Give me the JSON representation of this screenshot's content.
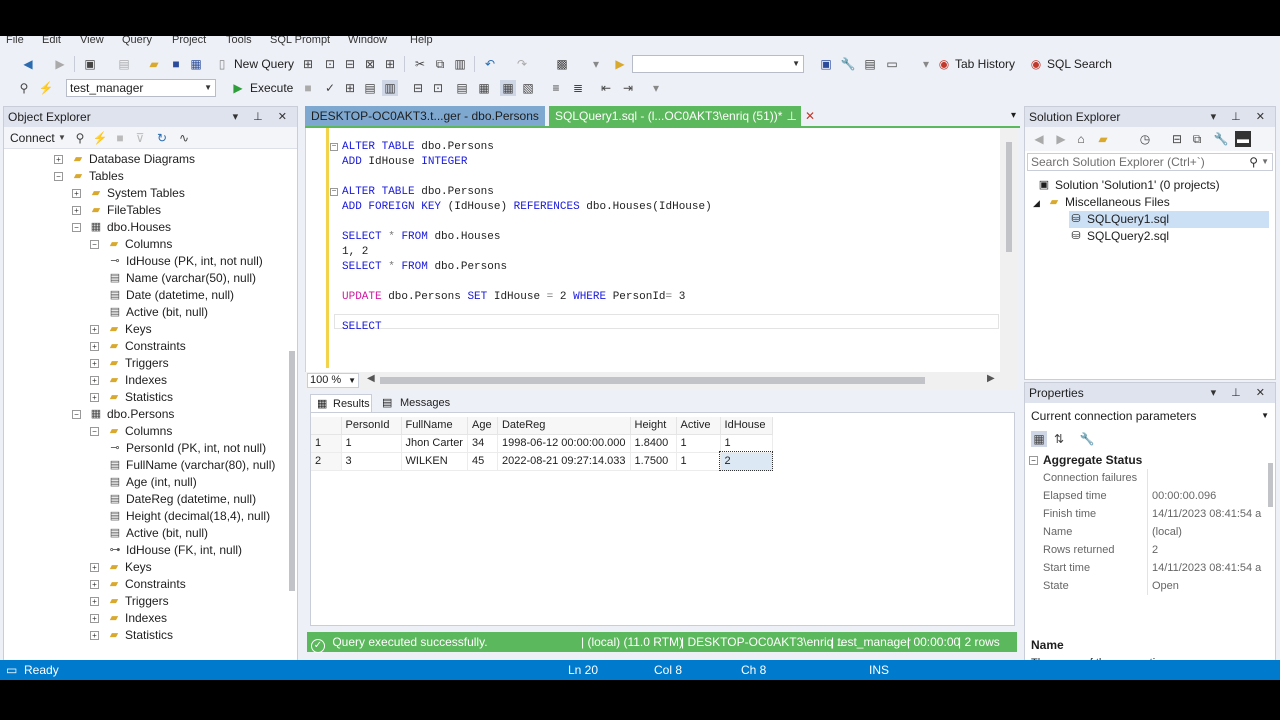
{
  "menu": [
    "File",
    "Edit",
    "View",
    "Query",
    "Project",
    "Tools",
    "SQL Prompt",
    "Window",
    "Help"
  ],
  "toolbar": {
    "new_query": "New Query",
    "execute": "Execute",
    "database": "test_manager",
    "tab_history": "Tab History",
    "sql_search": "SQL Search"
  },
  "object_explorer": {
    "title": "Object Explorer",
    "connect": "Connect",
    "nodes": [
      {
        "label": "Database Diagrams",
        "kind": "folder",
        "exp": "+"
      },
      {
        "label": "Tables",
        "kind": "folder",
        "exp": "-"
      },
      {
        "label": "System Tables",
        "kind": "folder",
        "exp": "+"
      },
      {
        "label": "FileTables",
        "kind": "folder",
        "exp": "+"
      },
      {
        "label": "dbo.Houses",
        "kind": "table",
        "exp": "-"
      },
      {
        "label": "Columns",
        "kind": "folder",
        "exp": "-"
      },
      {
        "label": "IdHouse (PK, int, not null)",
        "kind": "key",
        "exp": ""
      },
      {
        "label": "Name (varchar(50), null)",
        "kind": "col",
        "exp": ""
      },
      {
        "label": "Date (datetime, null)",
        "kind": "col",
        "exp": ""
      },
      {
        "label": "Active (bit, null)",
        "kind": "col",
        "exp": ""
      },
      {
        "label": "Keys",
        "kind": "folder",
        "exp": "+"
      },
      {
        "label": "Constraints",
        "kind": "folder",
        "exp": "+"
      },
      {
        "label": "Triggers",
        "kind": "folder",
        "exp": "+"
      },
      {
        "label": "Indexes",
        "kind": "folder",
        "exp": "+"
      },
      {
        "label": "Statistics",
        "kind": "folder",
        "exp": "+"
      },
      {
        "label": "dbo.Persons",
        "kind": "table",
        "exp": "-"
      },
      {
        "label": "Columns",
        "kind": "folder",
        "exp": "-"
      },
      {
        "label": "PersonId (PK, int, not null)",
        "kind": "key",
        "exp": ""
      },
      {
        "label": "FullName (varchar(80), null)",
        "kind": "col",
        "exp": ""
      },
      {
        "label": "Age (int, null)",
        "kind": "col",
        "exp": ""
      },
      {
        "label": "DateReg (datetime, null)",
        "kind": "col",
        "exp": ""
      },
      {
        "label": "Height (decimal(18,4), null)",
        "kind": "col",
        "exp": ""
      },
      {
        "label": "Active (bit, null)",
        "kind": "col",
        "exp": ""
      },
      {
        "label": "IdHouse (FK, int, null)",
        "kind": "fk",
        "exp": ""
      },
      {
        "label": "Keys",
        "kind": "folder",
        "exp": "+"
      },
      {
        "label": "Constraints",
        "kind": "folder",
        "exp": "+"
      },
      {
        "label": "Triggers",
        "kind": "folder",
        "exp": "+"
      },
      {
        "label": "Indexes",
        "kind": "folder",
        "exp": "+"
      },
      {
        "label": "Statistics",
        "kind": "folder",
        "exp": "+"
      }
    ]
  },
  "tabs": {
    "tab1": "DESKTOP-OC0AKT3.t...ger - dbo.Persons",
    "tab2": "SQLQuery1.sql - (l...OC0AKT3\\enriq (51))*"
  },
  "editor": {
    "l1": "ALTER TABLE dbo.Persons",
    "l2": "ADD IdHouse INTEGER",
    "l3": "ALTER TABLE dbo.Persons",
    "l4": "ADD FOREIGN KEY (IdHouse) REFERENCES dbo.Houses(IdHouse)",
    "l5": "SELECT * FROM dbo.Houses",
    "l6": "1, 2",
    "l7": "SELECT * FROM dbo.Persons",
    "l8": "UPDATE dbo.Persons SET IdHouse = 2 WHERE PersonId= 3",
    "l9": "SELECT ",
    "zoom": "100 %"
  },
  "results": {
    "tab_results": "Results",
    "tab_messages": "Messages",
    "columns": [
      "PersonId",
      "FullName",
      "Age",
      "DateReg",
      "Height",
      "Active",
      "IdHouse"
    ],
    "rows": [
      [
        "1",
        "1",
        "Jhon Carter",
        "34",
        "1998-06-12 00:00:00.000",
        "1.8400",
        "1",
        "1"
      ],
      [
        "2",
        "3",
        "WILKEN",
        "45",
        "2022-08-21 09:27:14.033",
        "1.7500",
        "1",
        "2"
      ]
    ]
  },
  "query_status": {
    "message": "Query executed successfully.",
    "server": "(local) (11.0 RTM)",
    "user": "DESKTOP-OC0AKT3\\enriq ...",
    "db": "test_manager",
    "time": "00:00:00",
    "rows": "2 rows"
  },
  "solution_explorer": {
    "title": "Solution Explorer",
    "search_placeholder": "Search Solution Explorer (Ctrl+`)",
    "solution": "Solution 'Solution1' (0 projects)",
    "misc": "Miscellaneous Files",
    "file1": "SQLQuery1.sql",
    "file2": "SQLQuery2.sql"
  },
  "properties": {
    "title": "Properties",
    "selector": "Current connection parameters",
    "category": "Aggregate Status",
    "rows": [
      {
        "k": "Connection failures",
        "v": ""
      },
      {
        "k": "Elapsed time",
        "v": "00:00:00.096"
      },
      {
        "k": "Finish time",
        "v": "14/11/2023 08:41:54 a."
      },
      {
        "k": "Name",
        "v": "(local)"
      },
      {
        "k": "Rows returned",
        "v": "2"
      },
      {
        "k": "Start time",
        "v": "14/11/2023 08:41:54 a."
      },
      {
        "k": "State",
        "v": "Open"
      }
    ],
    "desc_title": "Name",
    "desc_text": "The name of the connection."
  },
  "statusbar": {
    "ready": "Ready",
    "ln": "Ln 20",
    "col": "Col 8",
    "ch": "Ch 8",
    "ins": "INS"
  },
  "colors": {
    "accent_green": "#5cb85c",
    "status_blue": "#007acc",
    "keyword_blue": "#1a1adb",
    "keyword_pink": "#d11aa0"
  }
}
